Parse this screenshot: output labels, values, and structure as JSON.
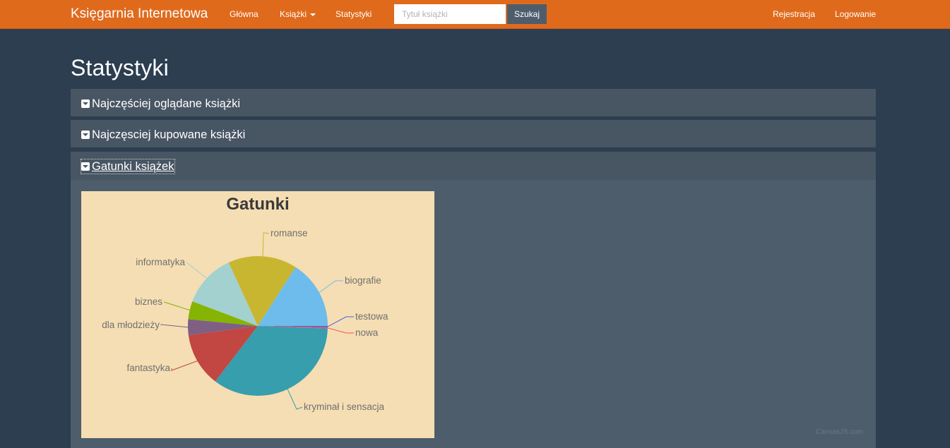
{
  "navbar": {
    "brand": "Księgarnia Internetowa",
    "home": "Główna",
    "books": "Książki",
    "stats": "Statystyki",
    "search_placeholder": "Tytuł książki",
    "search_button": "Szukaj",
    "register": "Rejestracja",
    "login": "Logowanie"
  },
  "page": {
    "title": "Statystyki"
  },
  "panels": [
    {
      "title": "Najczęściej oglądane książki",
      "expanded": false
    },
    {
      "title": "Najczęsciej kupowane książki",
      "expanded": false
    },
    {
      "title": "Gatunki książek",
      "expanded": true
    }
  ],
  "chart_data": {
    "type": "pie",
    "title": "Gatunki",
    "background": "#f5deb3",
    "series": [
      {
        "name": "testowa",
        "value": 0.3,
        "color": "#4661ee"
      },
      {
        "name": "nowa",
        "value": 0.3,
        "color": "#ec5657"
      },
      {
        "name": "kryminał i sensacja",
        "value": 35,
        "color": "#369ead"
      },
      {
        "name": "fantastyka",
        "value": 12.5,
        "color": "#c24642"
      },
      {
        "name": "dla młodzieży",
        "value": 3.7,
        "color": "#7f6084"
      },
      {
        "name": "biznes",
        "value": 4.2,
        "color": "#86b402"
      },
      {
        "name": "informatyka",
        "value": 12.5,
        "color": "#a2d1cf"
      },
      {
        "name": "romanse",
        "value": 16,
        "color": "#c8b631"
      },
      {
        "name": "biografie",
        "value": 16,
        "color": "#6dbceb"
      }
    ]
  },
  "credits": "CanvasJS.com"
}
